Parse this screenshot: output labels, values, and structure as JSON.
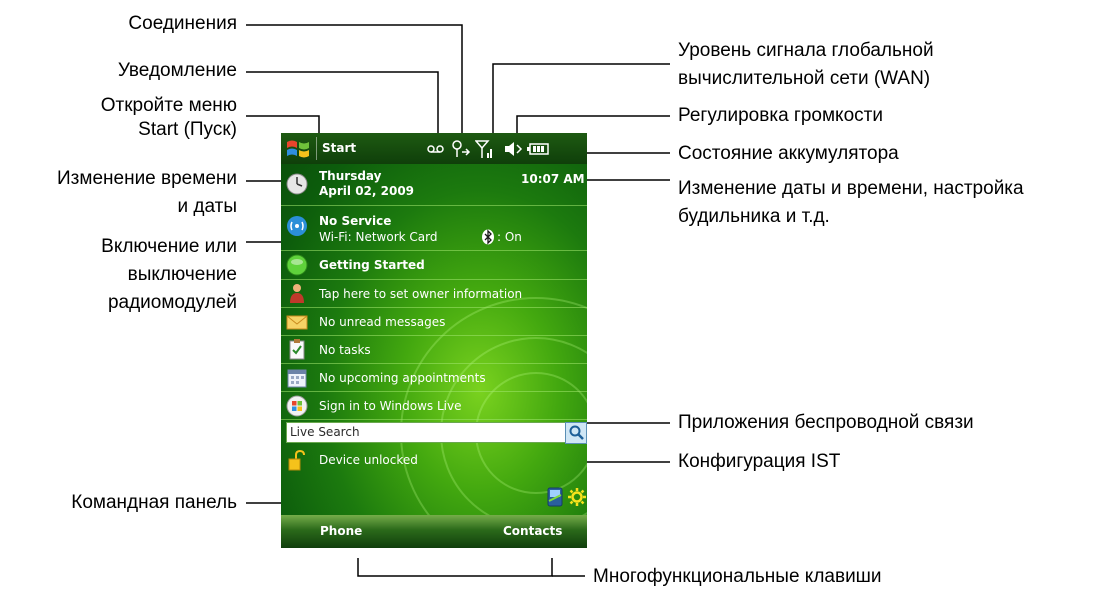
{
  "callouts": {
    "connections": "Соединения",
    "notification": "Уведомление",
    "open_start_line1": "Откройте меню",
    "open_start_line2": "Start (Пуск)",
    "change_time_line1": "Изменение времени",
    "change_time_line2": "и даты",
    "radio_line1": "Включение или",
    "radio_line2": "выключение",
    "radio_line3": "радиомодулей",
    "command_bar": "Командная панель",
    "wan_line1": "Уровень сигнала глобальной",
    "wan_line2": "вычислительной сети (WAN)",
    "volume": "Регулировка громкости",
    "battery": "Состояние аккумулятора",
    "date_alarm_line1": "Изменение даты и времени, настройка",
    "date_alarm_line2": "будильника и т.д.",
    "wireless_apps": "Приложения беспроводной связи",
    "ist_config": "Конфигурация IST",
    "soft_keys": "Многофункциональные клавиши"
  },
  "device": {
    "start_label": "Start",
    "day": "Thursday",
    "date": "April 02, 2009",
    "time": "10:07 AM",
    "service": "No Service",
    "wifi": "Wi-Fi: Network Card",
    "bt_status": ": On",
    "getting_started": "Getting Started",
    "owner": "Tap here to set owner information",
    "messages": "No unread messages",
    "tasks": "No tasks",
    "appointments": "No upcoming appointments",
    "live": "Sign in to Windows Live",
    "search_placeholder": "Live Search",
    "unlocked": "Device unlocked",
    "softkey_left": "Phone",
    "softkey_right": "Contacts"
  },
  "icons": [
    "windows-flag-icon",
    "voicemail-icon",
    "connectivity-icon",
    "signal-icon",
    "speaker-icon",
    "battery-icon",
    "clock-icon",
    "wireless-icon",
    "bluetooth-icon",
    "globe-icon",
    "owner-icon",
    "envelope-icon",
    "tasks-icon",
    "calendar-icon",
    "windows-live-icon",
    "search-icon",
    "lock-icon",
    "wireless-app-icon",
    "gear-icon"
  ]
}
